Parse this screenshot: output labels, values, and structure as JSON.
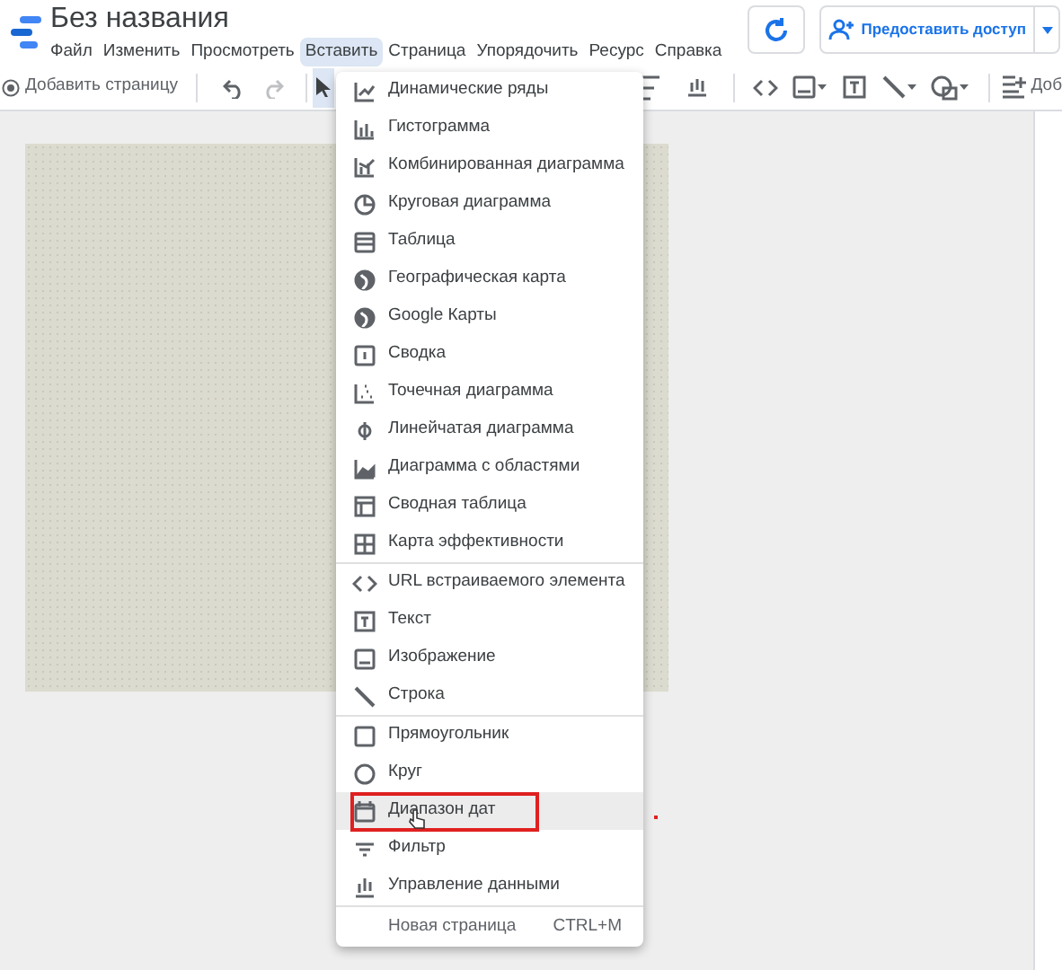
{
  "app": {
    "title": "Без названия"
  },
  "menu_bar": [
    {
      "label": "Файл",
      "selected": false
    },
    {
      "label": "Изменить",
      "selected": false
    },
    {
      "label": "Просмотреть",
      "selected": false
    },
    {
      "label": "Вставить",
      "selected": true
    },
    {
      "label": "Страница",
      "selected": false
    },
    {
      "label": "Упорядочить",
      "selected": false
    },
    {
      "label": "Ресурс",
      "selected": false
    },
    {
      "label": "Справка",
      "selected": false
    }
  ],
  "share_button": {
    "label": "Предоставить доступ"
  },
  "toolbar": {
    "add_page": "Добавить страницу",
    "add_cut": "Доб",
    "pointer_selected": true
  },
  "insert_menu": {
    "groups": [
      [
        {
          "label": "Динамические ряды",
          "hovered": false,
          "outlined": false
        },
        {
          "label": "Гистограмма",
          "hovered": false,
          "outlined": false
        },
        {
          "label": "Комбинированная диаграмма",
          "hovered": false,
          "outlined": false
        },
        {
          "label": "Круговая диаграмма",
          "hovered": false,
          "outlined": false
        },
        {
          "label": "Таблица",
          "hovered": false,
          "outlined": false
        },
        {
          "label": "Географическая карта",
          "hovered": false,
          "outlined": false
        },
        {
          "label": "Google Карты",
          "hovered": false,
          "outlined": false
        },
        {
          "label": "Сводка",
          "hovered": false,
          "outlined": false
        },
        {
          "label": "Точечная диаграмма",
          "hovered": false,
          "outlined": false
        },
        {
          "label": "Линейчатая диаграмма",
          "hovered": false,
          "outlined": false
        },
        {
          "label": "Диаграмма с областями",
          "hovered": false,
          "outlined": false
        },
        {
          "label": "Сводная таблица",
          "hovered": false,
          "outlined": false
        },
        {
          "label": "Карта эффективности",
          "hovered": false,
          "outlined": false
        }
      ],
      [
        {
          "label": "URL встраиваемого элемента",
          "hovered": false,
          "outlined": false
        },
        {
          "label": "Текст",
          "hovered": false,
          "outlined": false
        },
        {
          "label": "Изображение",
          "hovered": false,
          "outlined": false
        },
        {
          "label": "Строка",
          "hovered": false,
          "outlined": false
        }
      ],
      [
        {
          "label": "Прямоугольник",
          "hovered": false,
          "outlined": false
        },
        {
          "label": "Круг",
          "hovered": false,
          "outlined": false
        },
        {
          "label": "Диапазон дат",
          "hovered": true,
          "outlined": true
        },
        {
          "label": "Фильтр",
          "hovered": false,
          "outlined": false
        },
        {
          "label": "Управление данными",
          "hovered": false,
          "outlined": false
        }
      ]
    ],
    "footer": {
      "label": "Новая страница",
      "shortcut": "CTRL+M"
    }
  },
  "dot_marker": true
}
